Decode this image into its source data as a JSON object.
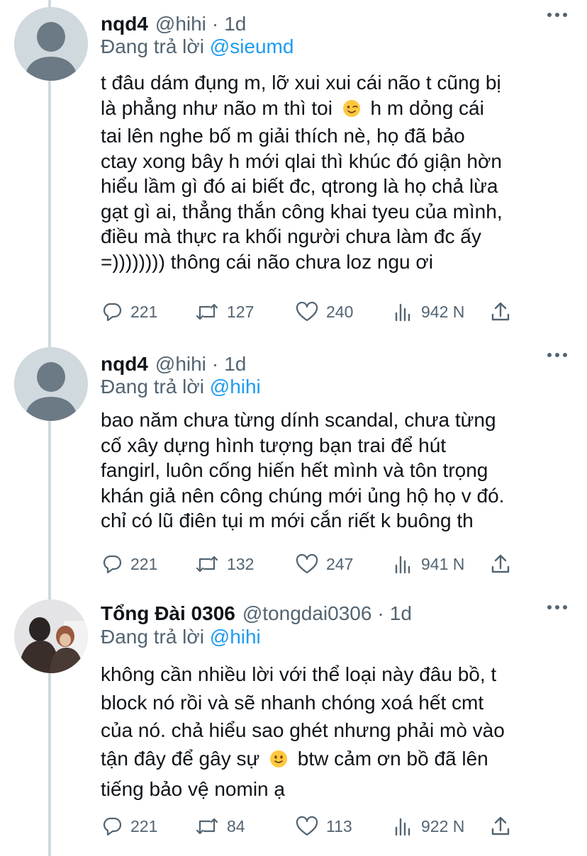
{
  "tweets": [
    {
      "name": "nqd4",
      "handle": "@hihi",
      "separator": "·",
      "time": "1d",
      "reply_prefix": "Đang trả lời",
      "reply_to": "@sieumd",
      "lines": [
        "t đâu dám đụng m, lỡ xui xui cái não t cũng bị",
        "là phẳng như não m thì toi",
        "h m dỏng cái",
        "tai lên nghe bố m giải thích nè, họ đã bảo",
        "ctay xong bây h mới qlai thì khúc đó giận hờn",
        "hiểu lầm gì đó ai biết đc, qtrong là họ chả lừa",
        "gạt gì ai, thẳng thắn công khai tyeu của mình,",
        "điều mà thực ra khối người chưa làm đc ấy",
        "=)))))))) thông cái não chưa loz ngu ơi"
      ],
      "emoji": "winking-face-emoji",
      "replies": "221",
      "retweets": "127",
      "likes": "240",
      "views": "942 N"
    },
    {
      "name": "nqd4",
      "handle": "@hihi",
      "separator": "·",
      "time": "1d",
      "reply_prefix": "Đang trả lời",
      "reply_to": "@hihi",
      "lines": [
        "bao năm chưa từng dính scandal, chưa từng",
        "cố xây dựng hình tượng bạn trai để hút",
        "fangirl, luôn cống hiến hết mình và tôn trọng",
        "khán giả nên công chúng mới ủng hộ họ v đó.",
        "chỉ có lũ điên tụi m mới cắn riết k buông th"
      ],
      "replies": "221",
      "retweets": "132",
      "likes": "247",
      "views": "941 N"
    },
    {
      "name": "Tổng Đài 0306",
      "handle": "@tongdai0306",
      "separator": "·",
      "time": "1d",
      "reply_prefix": "Đang trả lời",
      "reply_to": "@hihi",
      "lines": [
        "không cần nhiều lời với thể loại này đâu bồ, t",
        "block nó rồi và sẽ nhanh chóng xoá hết cmt",
        "của nó. chả hiểu sao ghét nhưng phải mò vào",
        "tận đây để gây sự",
        "btw cảm ơn bồ đã lên",
        "tiếng bảo vệ nomin ạ"
      ],
      "emoji": "smiling-face-emoji",
      "replies": "221",
      "retweets": "84",
      "likes": "113",
      "views": "922 N"
    }
  ],
  "colors": {
    "text": "#0f1419",
    "secondary": "#536471",
    "mention": "#1d9bf0",
    "thread_line": "#cfd9de"
  }
}
